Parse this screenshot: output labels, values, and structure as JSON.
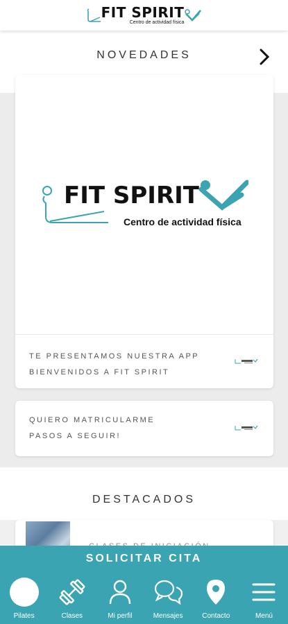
{
  "app": {
    "logo_title": "FIT SPIRIT",
    "logo_subtitle": "Centro de actividad física",
    "accent_color": "#3ba4b2"
  },
  "novedades": {
    "title": "NOVEDADES",
    "next_icon": "chevron-right-icon",
    "hero": {
      "logo_title": "FIT SPIRIT",
      "logo_subtitle": "Centro de actividad física",
      "line1": "TE PRESENTAMOS NUESTRA APP",
      "line2": "BIENVENIDOS A FIT SPIRIT"
    },
    "item2": {
      "line1": "QUIERO MATRICULARME",
      "line2": "PASOS A SEGUIR!"
    }
  },
  "destacados": {
    "title": "DESTACADOS",
    "item1": {
      "title": "CLASES DE INICIACIÓN"
    }
  },
  "cta": {
    "label": "SOLICITAR CITA"
  },
  "nav": {
    "items": [
      {
        "label": "Pilates",
        "icon": "circle-icon"
      },
      {
        "label": "Clases",
        "icon": "dumbbell-icon"
      },
      {
        "label": "Mi perfil",
        "icon": "user-icon"
      },
      {
        "label": "Mensajes",
        "icon": "chat-icon"
      },
      {
        "label": "Contacto",
        "icon": "location-pin-icon"
      },
      {
        "label": "Menú",
        "icon": "hamburger-menu-icon"
      }
    ]
  }
}
